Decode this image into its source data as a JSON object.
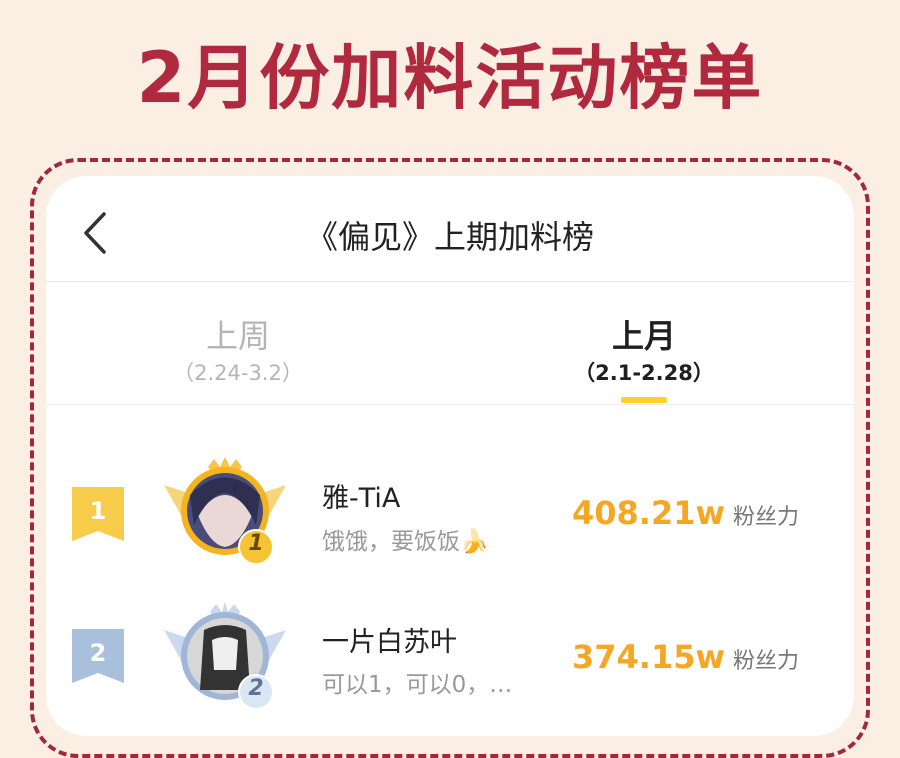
{
  "banner": {
    "title": "2月份加料活动榜单"
  },
  "header": {
    "title": "《偏见》上期加料榜"
  },
  "tabs": [
    {
      "label": "上周",
      "range": "（2.24-3.2）",
      "active": false
    },
    {
      "label": "上月",
      "range": "（2.1-2.28）",
      "active": true
    }
  ],
  "ranking": [
    {
      "rank": "1",
      "name": "雅-TiA",
      "subtitle": "饿饿，要饭饭🍌",
      "score": "408.21w",
      "unit": "粉丝力",
      "medal": "1"
    },
    {
      "rank": "2",
      "name": "一片白苏叶",
      "subtitle": "可以1，可以0，…",
      "score": "374.15w",
      "unit": "粉丝力",
      "medal": "2"
    }
  ],
  "colors": {
    "brand": "#b0293f",
    "accent": "#ffd02e",
    "score": "#f5a623",
    "background": "#fbeee3"
  }
}
